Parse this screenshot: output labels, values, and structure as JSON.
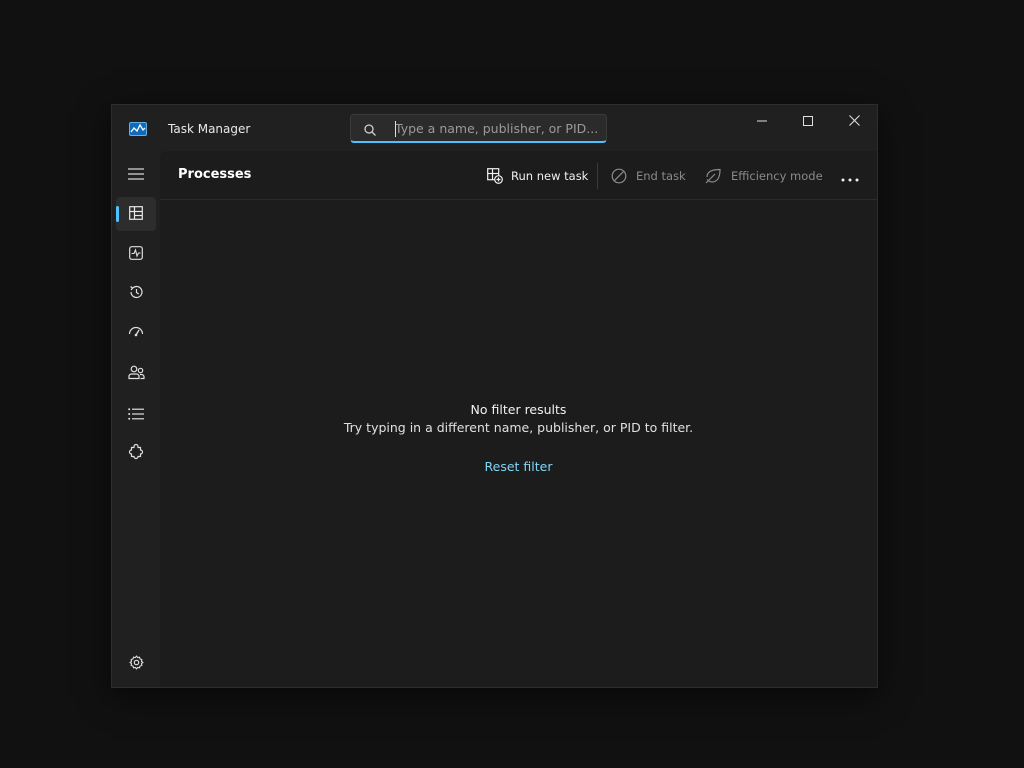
{
  "window": {
    "title": "Task Manager",
    "app_icon": "task-manager-icon"
  },
  "search": {
    "placeholder": "Type a name, publisher, or PID...",
    "value": "",
    "icon": "search-icon"
  },
  "window_controls": {
    "minimize_icon": "minimize-icon",
    "maximize_icon": "maximize-icon",
    "close_icon": "close-icon"
  },
  "sidebar": {
    "items": [
      {
        "icon": "hamburger-menu-icon"
      },
      {
        "icon": "processes-icon",
        "active": true
      },
      {
        "icon": "performance-icon"
      },
      {
        "icon": "app-history-icon"
      },
      {
        "icon": "startup-apps-icon"
      },
      {
        "icon": "users-icon"
      },
      {
        "icon": "details-icon"
      },
      {
        "icon": "services-icon"
      }
    ],
    "settings_icon": "gear-icon"
  },
  "toolbar": {
    "page_title": "Processes",
    "run_new_task": "Run new task",
    "end_task": "End task",
    "efficiency_mode": "Efficiency mode",
    "more_icon": "more-icon"
  },
  "empty_state": {
    "title": "No filter results",
    "message": "Try typing in a different name, publisher, or PID to filter.",
    "reset_label": "Reset filter"
  },
  "colors": {
    "accent": "#4cc2ff",
    "link": "#7fd6f5",
    "window_bg": "#202020",
    "content_bg": "#1c1c1c"
  }
}
